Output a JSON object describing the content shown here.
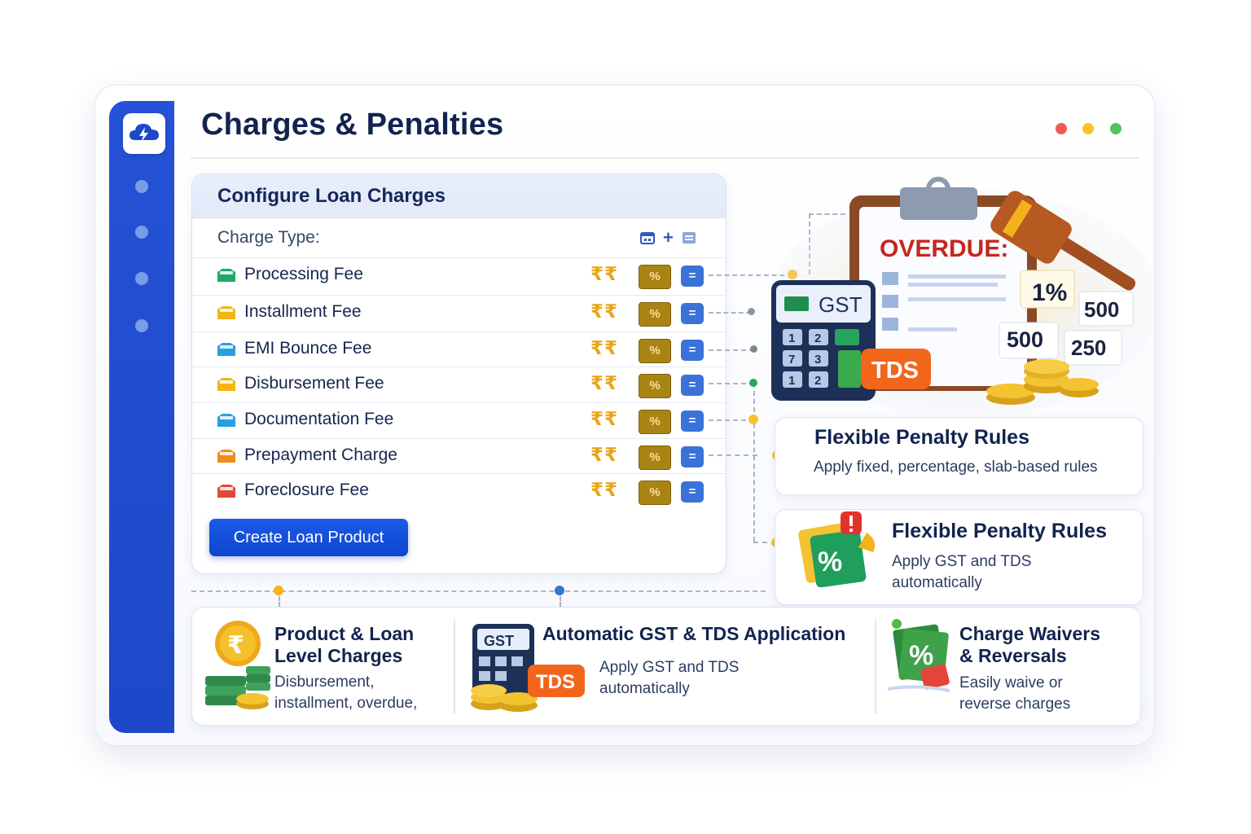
{
  "app": {
    "title": "Charges & Penalties"
  },
  "window_controls": {
    "colors": [
      "#f25a57",
      "#f7c326",
      "#4fc45e"
    ]
  },
  "sidebar": {
    "logo_icon": "cloud-bolt-icon",
    "nav_count": 4
  },
  "config_panel": {
    "title": "Configure Loan Charges",
    "charge_type_label": "Charge Type:",
    "toolbar_icons": [
      "calendar-icon",
      "plus-icon",
      "list-icon"
    ],
    "plus_glyph": "+",
    "rupee_glyph": "₹₹",
    "percent_glyph": "%",
    "equals_glyph": "=",
    "rows": [
      {
        "label": "Processing Fee",
        "icon_color": "#20a86b"
      },
      {
        "label": "Installment Fee",
        "icon_color": "#f2b514"
      },
      {
        "label": "EMI Bounce Fee",
        "icon_color": "#2a9fe0"
      },
      {
        "label": "Disbursement Fee",
        "icon_color": "#f2b514"
      },
      {
        "label": "Documentation Fee",
        "icon_color": "#2a9fe0"
      },
      {
        "label": "Prepayment Charge",
        "icon_color": "#f28a1a"
      },
      {
        "label": "Foreclosure Fee",
        "icon_color": "#e04a3a"
      }
    ],
    "create_button": "Create Loan Product"
  },
  "illustration": {
    "overdue": "OVERDUE:",
    "gst": "GST",
    "tds": "TDS",
    "tiles": [
      "1%",
      "500",
      "500",
      "250"
    ],
    "keys": [
      "1",
      "2",
      "7",
      "3",
      "1",
      "2"
    ]
  },
  "feature_cards": [
    {
      "title": "Flexible Penalty Rules",
      "desc": "Apply fixed, percentage, slab-based rules"
    },
    {
      "title": "Flexible Penalty Rules",
      "desc_lines": [
        "Apply GST and TDS",
        "automatically"
      ]
    }
  ],
  "bottom_features": [
    {
      "title_lines": [
        "Product & Loan",
        "Level Charges"
      ],
      "desc_lines": [
        "Disbursement,",
        "installment, overdue,"
      ],
      "icon": "rupee-coin-icon",
      "icon_glyph": "₹"
    },
    {
      "title": "Automatic GST & TDS Application",
      "desc_lines": [
        "Apply GST and TDS",
        "automatically"
      ],
      "icon": "gst-calculator-icon",
      "gst": "GST",
      "tds": "TDS"
    },
    {
      "title_lines": [
        "Charge Waivers",
        "& Reversals"
      ],
      "desc_lines": [
        "Easily waive or",
        "reverse charges"
      ],
      "icon": "percent-tag-icon",
      "icon_glyph": "%"
    }
  ],
  "accent_colors": {
    "primary": "#1c48c9",
    "gold": "#e8a516",
    "orange": "#f2661c",
    "green": "#1f9e5c"
  }
}
